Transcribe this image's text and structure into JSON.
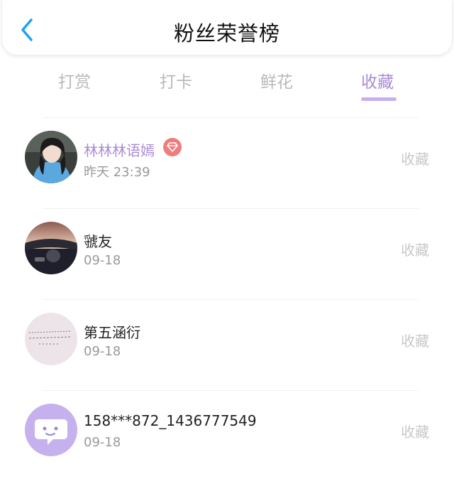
{
  "header": {
    "title": "粉丝荣誉榜",
    "back_icon": "chevron-left-icon",
    "accent": "#1fa3f0"
  },
  "tabs": [
    {
      "label": "打赏",
      "active": false
    },
    {
      "label": "打卡",
      "active": false
    },
    {
      "label": "鲜花",
      "active": false
    },
    {
      "label": "收藏",
      "active": true
    }
  ],
  "colors": {
    "active_tab": "#a98bd6",
    "inactive_tab": "#b9b9b9",
    "vip_name": "#a98bd6",
    "badge": "#ef7d7d"
  },
  "fans": [
    {
      "name": "林林林语嫣",
      "time": "昨天 23:39",
      "action": "收藏",
      "vip": true,
      "avatar_icon": "girl-photo-avatar"
    },
    {
      "name": "虢友",
      "time": "09-18",
      "action": "收藏",
      "vip": false,
      "avatar_icon": "car-sunset-photo-avatar"
    },
    {
      "name": "第五涵衍",
      "time": "09-18",
      "action": "收藏",
      "vip": false,
      "avatar_icon": "handwriting-note-avatar"
    },
    {
      "name": "158***872_1436777549",
      "time": "09-18",
      "action": "收藏",
      "vip": false,
      "avatar_icon": "chat-bubble-default-avatar"
    }
  ]
}
